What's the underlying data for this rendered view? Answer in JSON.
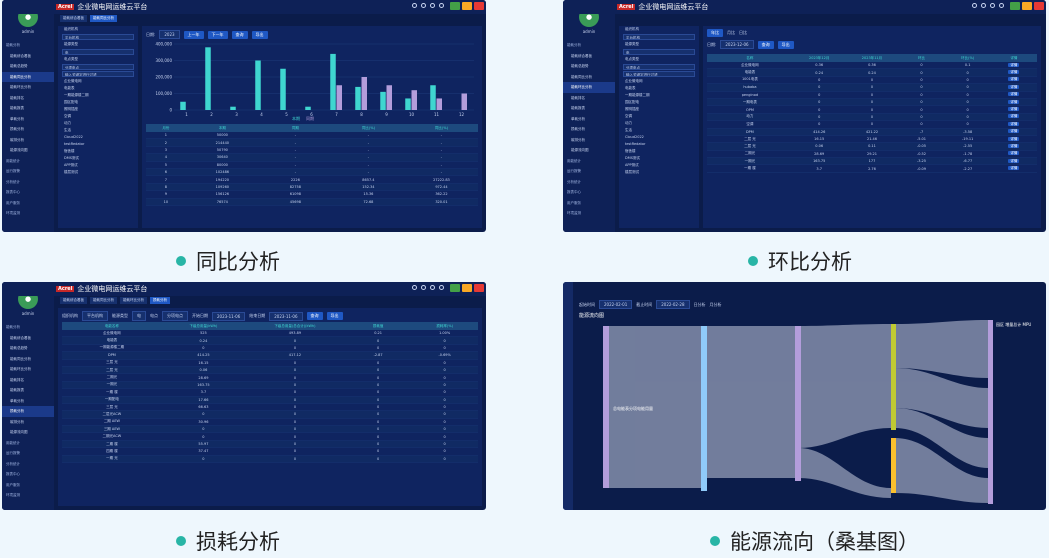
{
  "captions": [
    "同比分析",
    "环比分析",
    "损耗分析",
    "能源流向（桑基图）"
  ],
  "brand": {
    "mark": "Acrel",
    "title": "企业微电网运维云平台",
    "user": "admin"
  },
  "sidebar_items": [
    "能耗分析",
    "能耗综合看板",
    "能耗总趋势",
    "能耗同比分析",
    "能耗环比分析",
    "能耗排名",
    "能耗报表",
    "单耗分析",
    "损耗分析",
    "碳排分析",
    "能源流向图",
    "用能统计",
    "运行报警",
    "分析统计",
    "报表中心",
    "用户服务",
    "环境监测"
  ],
  "tree": {
    "org_label": "组织机构",
    "org_value": "平台机构",
    "energy_label": "能源类型",
    "energy_value": "电",
    "type_label": "电点类型",
    "type_value": "分项电点",
    "search": "输入关键字进行过滤",
    "nodes": [
      "企业微电网",
      "电能表",
      "一期能源楼二期",
      "园区配电",
      "照明插座",
      "空调",
      "动力",
      "生活",
      "Cloud2022",
      "testRedator",
      "宿舍楼",
      "DMS测试",
      "APP测试",
      "楼层测试"
    ]
  },
  "p1": {
    "tabs": [
      "能耗综合看板",
      "能耗同比分析"
    ],
    "date_label": "日期:",
    "date_value": "2023",
    "prev": "上一年",
    "next": "下一年",
    "query": "查询",
    "export": "导出",
    "legend": [
      "本期",
      "同期"
    ],
    "chart_data": {
      "type": "bar",
      "categories": [
        "1",
        "2",
        "3",
        "4",
        "5",
        "6",
        "7",
        "8",
        "9",
        "10",
        "11",
        "12"
      ],
      "series": [
        {
          "name": "本期",
          "values": [
            50000,
            380000,
            20000,
            300000,
            250000,
            20000,
            340000,
            140000,
            110000,
            70000,
            150000,
            0
          ]
        },
        {
          "name": "同期",
          "values": [
            0,
            0,
            0,
            0,
            0,
            0,
            150000,
            200000,
            150000,
            120000,
            70000,
            100000
          ]
        }
      ],
      "ylim": [
        0,
        400000
      ],
      "yticks": [
        "0",
        "100,000",
        "200,000",
        "300,000",
        "400,000"
      ]
    },
    "table": {
      "headers": [
        "月份",
        "本期",
        "同期",
        "同比(%)",
        "同比(%)"
      ],
      "rows": [
        [
          "1",
          "50000",
          "-",
          "-",
          "-"
        ],
        [
          "2",
          "214440",
          "-",
          "-",
          "-"
        ],
        [
          "3",
          "50790",
          "-",
          "-",
          "-"
        ],
        [
          "4",
          "30640",
          "-",
          "-",
          "-"
        ],
        [
          "5",
          "80000",
          "-",
          "-",
          "-"
        ],
        [
          "6",
          "102486",
          "-",
          "-",
          "-"
        ],
        [
          "7",
          "194220",
          "2226",
          "8657.4",
          "27222.83"
        ],
        [
          "8",
          "109260",
          "82758",
          "152.34",
          "972.44"
        ],
        [
          "9",
          "156126",
          "61098",
          "15.36",
          "362.22"
        ],
        [
          "10",
          "76574",
          "45698",
          "72.68",
          "320.01"
        ]
      ]
    }
  },
  "p2": {
    "subtabs": [
      "年比",
      "月比",
      "日比"
    ],
    "date_label": "日期:",
    "date_value": "2023-12-06",
    "query": "查询",
    "export": "导出",
    "table": {
      "headers": [
        "名称",
        "2023年12月",
        "2023年11月",
        "环比",
        "环比(%)",
        "详情"
      ],
      "rows": [
        [
          "企业微电网",
          "0.36",
          "0.36",
          "0",
          "0.1",
          "详情"
        ],
        [
          "电能表",
          "0.24",
          "0.24",
          "0",
          "0",
          "详情"
        ],
        [
          "1001电表",
          "0",
          "0",
          "0",
          "0",
          "详情"
        ],
        [
          "hubaba",
          "0",
          "0",
          "0",
          "0",
          "详情"
        ],
        [
          "penginod",
          "0",
          "0",
          "0",
          "0",
          "详情"
        ],
        [
          "一期电表",
          "0",
          "0",
          "0",
          "0",
          "详情"
        ],
        [
          "OPM",
          "0",
          "0",
          "0",
          "0",
          "详情"
        ],
        [
          "动力",
          "0",
          "0",
          "0",
          "0",
          "详情"
        ],
        [
          "空调",
          "0",
          "0",
          "0",
          "0",
          "详情"
        ],
        [
          "DPM",
          "414.26",
          "421.22",
          "-7",
          "-3.58",
          "详情"
        ],
        [
          "二层 光",
          "16.15",
          "21.46",
          "-5.01",
          "-19.11",
          "详情"
        ],
        [
          "二层 光",
          "0.06",
          "0.11",
          "-0.05",
          "-2.55",
          "详情"
        ],
        [
          "二期光",
          "28.69",
          "29.21",
          "-0.52",
          "-1.78",
          "详情"
        ],
        [
          "一期光",
          "163.75",
          "177",
          "-3.25",
          "-6.77",
          "详情"
        ],
        [
          "一期 楼",
          "3.7",
          "2.76",
          "-0.09",
          "-2.27",
          "详情"
        ]
      ]
    }
  },
  "p3": {
    "tabs": [
      "能耗综合看板",
      "能耗同比分析",
      "能耗环比分析",
      "损耗分析"
    ],
    "org_label": "组织机构",
    "org_value": "平台机构",
    "energy_label": "能源类型",
    "energy_value": "电",
    "type_label": "电点",
    "type_value": "分项电点",
    "start_label": "开始日期",
    "start_value": "2023-11-06",
    "end_label": "结束日期",
    "end_value": "2023-11-06",
    "query": "查询",
    "export": "导出",
    "table": {
      "headers": [
        "电能名称",
        "下级总用量(kWh)",
        "下级总用量(总合计)(kWh)",
        "损耗值",
        "损耗率(%)"
      ],
      "rows": [
        [
          "企业微电网",
          "525",
          "493.89",
          "0.21",
          "1.00%"
        ],
        [
          "电能表",
          "0.24",
          "0",
          "0",
          "0"
        ],
        [
          "一期能源楼二期",
          "0",
          "0",
          "0",
          "0"
        ],
        [
          "DPM",
          "414.25",
          "417.12",
          "-2.87",
          "-0.69%"
        ],
        [
          "三层 光",
          "16.15",
          "0",
          "0",
          "0"
        ],
        [
          "二层 光",
          "0.06",
          "0",
          "0",
          "0"
        ],
        [
          "二期光",
          "28.69",
          "0",
          "0",
          "0"
        ],
        [
          "一期光",
          "163.75",
          "0",
          "0",
          "0"
        ],
        [
          "一期 楼",
          "3.7",
          "0",
          "0",
          "0"
        ],
        [
          "一期配电",
          "17.66",
          "0",
          "0",
          "0"
        ],
        [
          "三层 光",
          "66.63",
          "0",
          "0",
          "0"
        ],
        [
          "二层光ACW",
          "0",
          "0",
          "0",
          "0"
        ],
        [
          "二期 AEW",
          "30.96",
          "0",
          "0",
          "0"
        ],
        [
          "三期 AEW",
          "0",
          "0",
          "0",
          "0"
        ],
        [
          "二期光ACW",
          "0",
          "0",
          "0",
          "0"
        ],
        [
          "二期 楼",
          "55.97",
          "0",
          "0",
          "0"
        ],
        [
          "四期 楼",
          "37.47",
          "0",
          "0",
          "0"
        ],
        [
          "一期 光",
          "0",
          "0",
          "0",
          "0"
        ]
      ]
    }
  },
  "p4": {
    "title": "能源流向图",
    "start_label": "起始时间",
    "start_value": "2022-02-01",
    "end_label": "截止时间",
    "end_value": "2022-02-28",
    "radio1": "日分析",
    "radio2": "月分析",
    "left_label": "总电能表分项电能用量",
    "right_label": "园区 增量总计 MPU"
  }
}
